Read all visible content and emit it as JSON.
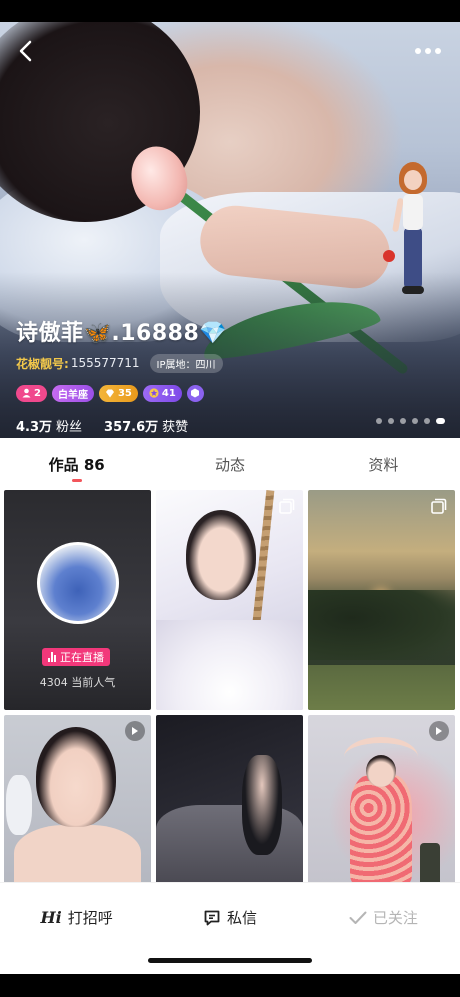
{
  "header": {
    "back_icon": "chevron-left-icon",
    "more_icon": "more-dots-icon"
  },
  "profile": {
    "name": "诗傲菲🦋.16888💎",
    "id_label": "花椒靓号:",
    "id_value": "155577711",
    "ip_location": "IP属地：四川",
    "badges": [
      {
        "icon": "person-icon",
        "text": "2"
      },
      {
        "icon": "",
        "text": "白羊座"
      },
      {
        "icon": "diamond-icon",
        "text": "35"
      },
      {
        "icon": "star-icon",
        "text": "41"
      },
      {
        "icon": "hexagon-icon",
        "text": ""
      }
    ],
    "stats": {
      "fans_value": "4.3万",
      "fans_label": "粉丝",
      "likes_value": "357.6万",
      "likes_label": "获赞"
    },
    "carousel": {
      "count": 6,
      "active_index": 5
    }
  },
  "tabs": [
    {
      "label": "作品 86",
      "active": true
    },
    {
      "label": "动态",
      "active": false
    },
    {
      "label": "资料",
      "active": false
    }
  ],
  "grid": {
    "live_tag": "正在直播",
    "popularity": "4304 当前人气",
    "items": [
      {
        "type": "live"
      },
      {
        "type": "album"
      },
      {
        "type": "album"
      },
      {
        "type": "video"
      },
      {
        "type": "video"
      },
      {
        "type": "video"
      }
    ]
  },
  "bottom_bar": {
    "greet_hi": "Hi",
    "greet_label": "打招呼",
    "message_label": "私信",
    "followed_label": "已关注"
  },
  "colors": {
    "accent": "#f2555b",
    "live_pink": "#f2387a",
    "id_gold": "#f2c84b"
  }
}
